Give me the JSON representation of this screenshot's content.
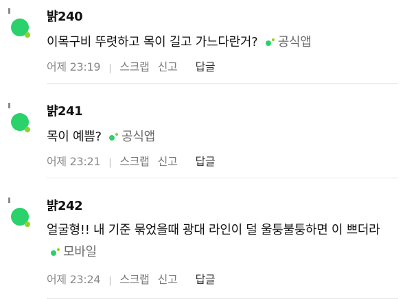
{
  "comments": [
    {
      "nick": "뱕240",
      "text": "이목구비 뚜렷하고 목이 길고 가느다란거?",
      "device": "공식앱",
      "time": "어제 23:19",
      "actions": {
        "scrap": "스크랩",
        "report": "신고",
        "reply": "답글"
      }
    },
    {
      "nick": "뱕241",
      "text": "목이 예쁨?",
      "device": "공식앱",
      "time": "어제 23:21",
      "actions": {
        "scrap": "스크랩",
        "report": "신고",
        "reply": "답글"
      }
    },
    {
      "nick": "뱕242",
      "text": "얼굴형!! 내 기준 묶었을때 광대 라인이 덜 울퉁불퉁하면 이 쁘더라",
      "device": "모바일",
      "time": "어제 23:24",
      "actions": {
        "scrap": "스크랩",
        "report": "신고",
        "reply": "답글"
      }
    }
  ],
  "colors": {
    "avatar": "#2bd16a",
    "avatar_accent": "#8bd42a"
  },
  "icons": {
    "avatar": "avatar-icon",
    "device": "device-dot-icon"
  }
}
